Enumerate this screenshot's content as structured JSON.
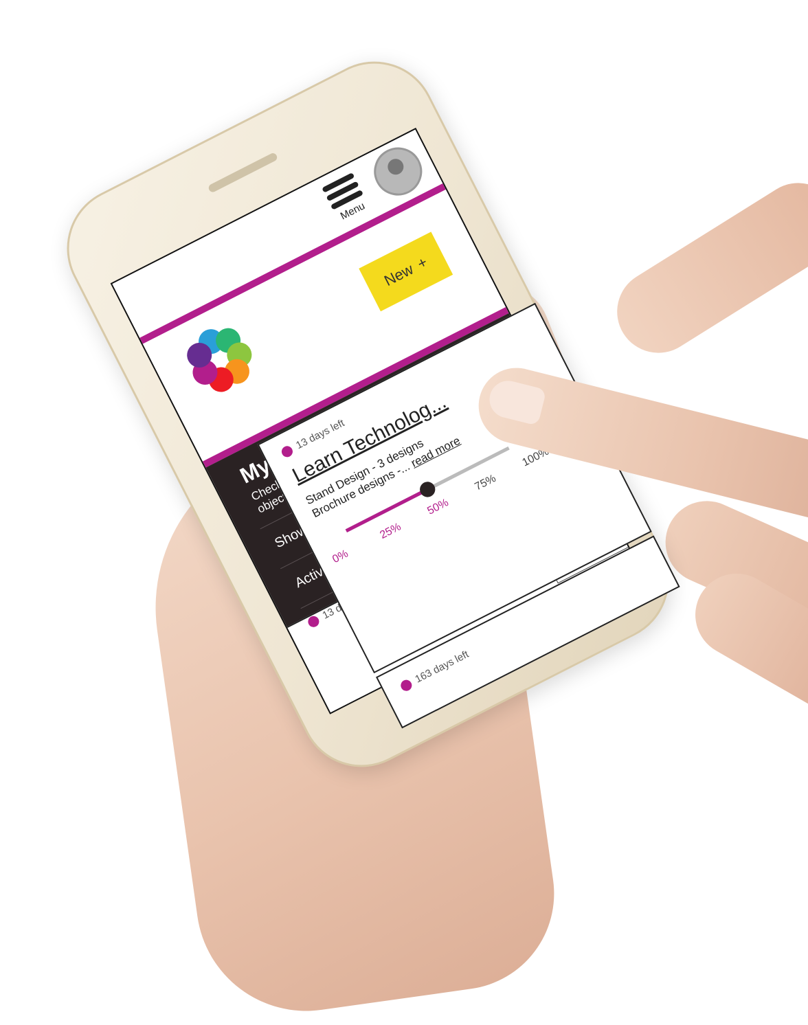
{
  "header": {
    "menu_label": "Menu",
    "new_button": "New",
    "new_icon": "plus-icon"
  },
  "objectives": {
    "title": "My Objectives",
    "subtitle": "Check, track, prioritise and archive your objectives here with ease",
    "filter_show": "Show Active objectives (4)",
    "filter_active": "Active objectives (4)"
  },
  "cards": [
    {
      "days_left": "13 days left",
      "title": "Learn Technolog...",
      "desc_line1": "Stand Design - 3 designs",
      "desc_line2": "Brochure designs -...",
      "read_more": "read more",
      "progress": 0.5,
      "ticks": [
        "0%",
        "25%",
        "50%",
        "75%",
        "100%"
      ]
    },
    {
      "days_left": "163 days left"
    }
  ],
  "colors": {
    "accent": "#b21e8c",
    "dark": "#2a2223",
    "button": "#f4da1d"
  }
}
